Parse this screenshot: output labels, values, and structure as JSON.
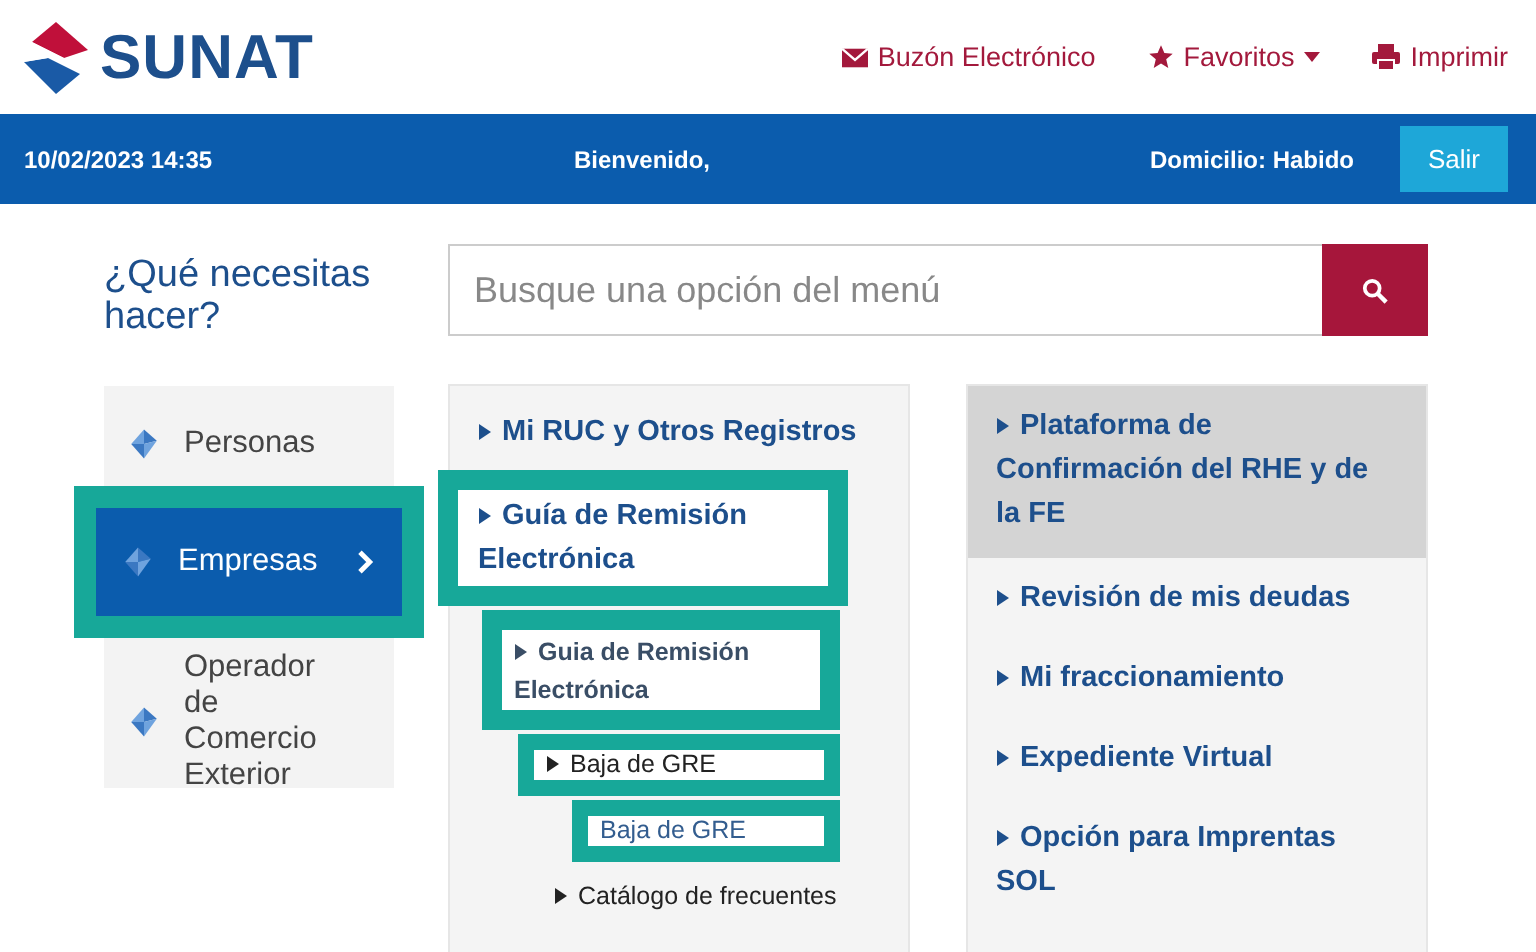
{
  "header": {
    "logo_text": "SUNAT",
    "links": [
      {
        "kind": "mail",
        "label": "Buzón Electrónico"
      },
      {
        "kind": "favorites",
        "label": "Favoritos"
      },
      {
        "kind": "print",
        "label": "Imprimir"
      }
    ]
  },
  "user_bar": {
    "datetime": "10/02/2023 14:35",
    "greeting": "Bienvenido,",
    "domicile": "Domicilio: Habido",
    "logout": "Salir"
  },
  "question": "¿Qué necesitas hacer?",
  "search": {
    "placeholder": "Busque una opción del menú"
  },
  "profiles": [
    {
      "label": "Personas",
      "selected": false,
      "highlighted": false
    },
    {
      "label": "Empresas",
      "selected": true,
      "highlighted": true
    },
    {
      "label": "Operador de Comercio Exterior",
      "selected": false,
      "highlighted": false
    }
  ],
  "menu": [
    {
      "label": "Mi RUC y Otros Registros",
      "kind": "branch",
      "highlighted": false
    },
    {
      "label": "Guía de Remisión Electrónica",
      "kind": "branch",
      "highlighted": true,
      "children": [
        {
          "label": "Guia de Remisión Electrónica",
          "kind": "branch",
          "highlighted": true,
          "children": [
            {
              "label": "Baja de GRE",
              "kind": "branch",
              "highlighted": true,
              "children": [
                {
                  "label": "Baja de GRE",
                  "kind": "link",
                  "highlighted": true
                }
              ]
            },
            {
              "label": "Catálogo de frecuentes",
              "kind": "branch",
              "highlighted": false
            }
          ]
        }
      ]
    }
  ],
  "frequent": [
    {
      "label": "Plataforma de Confirmación del RHE y de la FE",
      "selected": true
    },
    {
      "label": "Revisión de mis deudas",
      "selected": false
    },
    {
      "label": "Mi fraccionamiento",
      "selected": false
    },
    {
      "label": "Expediente Virtual",
      "selected": false
    },
    {
      "label": "Opción para Imprentas SOL",
      "selected": false
    }
  ]
}
